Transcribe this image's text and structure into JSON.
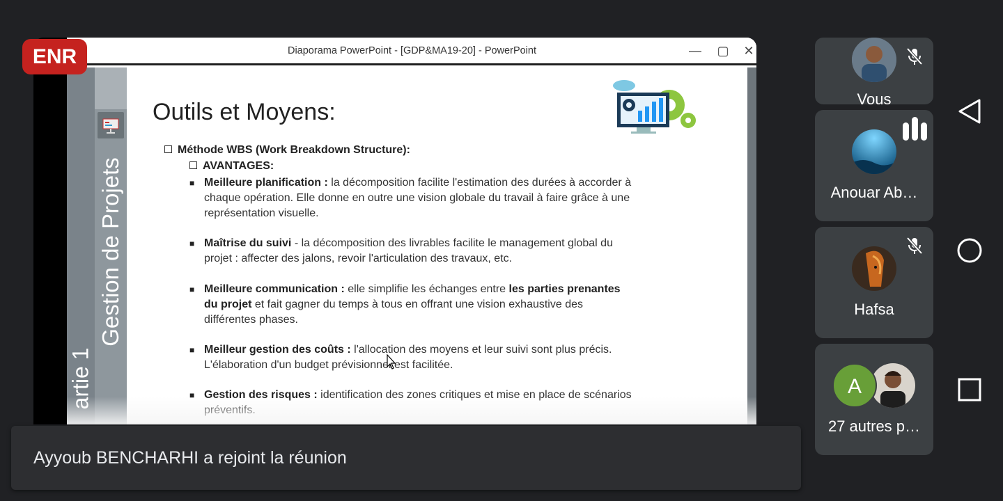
{
  "recording_badge": "ENR",
  "shared_window": {
    "title": "Diaporama PowerPoint - [GDP&MA19-20] - PowerPoint",
    "controls": {
      "minimize": "—",
      "maximize": "▢",
      "close": "✕"
    }
  },
  "slide": {
    "side_title": "Gestion de Projets",
    "part_label": "artie 1",
    "heading": "Outils et Moyens:",
    "wbs_line": "Méthode WBS (Work Breakdown Structure):",
    "avantages": "AVANTAGES:",
    "bullets": [
      {
        "bold": "Meilleure planification :",
        "text": " la décomposition facilite l'estimation des durées à accorder à chaque opération. Elle donne en outre une vision globale du travail à faire grâce à une représentation visuelle."
      },
      {
        "bold": "Maîtrise du suivi",
        "text": " - la décomposition des livrables facilite le management global du projet : affecter des jalons, revoir l'articulation des travaux, etc."
      },
      {
        "bold": "Meilleure communication :",
        "text": " elle simplifie les échanges entre ",
        "bold2": "les parties prenantes du projet",
        "text2": " et fait gagner du temps à tous en offrant une vision exhaustive des différentes phases."
      },
      {
        "bold": "Meilleur gestion des coûts :",
        "text": " l'allocation des moyens et leur suivi sont plus précis. L'élaboration d'un budget prévisionnel est facilitée."
      },
      {
        "bold": "Gestion des risques :",
        "text": " identification des zones critiques et mise en place de scénarios préventifs."
      }
    ]
  },
  "participants": [
    {
      "name": "Vous",
      "muted": true
    },
    {
      "name": "Anouar Ab…",
      "speaking": true
    },
    {
      "name": "Hafsa",
      "muted": true
    },
    {
      "name": "27 autres p…",
      "avatar_letter": "A"
    }
  ],
  "colors": {
    "meet_bg": "#202124",
    "tile_bg": "#3c4043",
    "recording_red": "#c5221f",
    "avatar_green": "#689f38"
  },
  "toast": {
    "message": "Ayyoub BENCHARHI a rejoint la réunion"
  }
}
